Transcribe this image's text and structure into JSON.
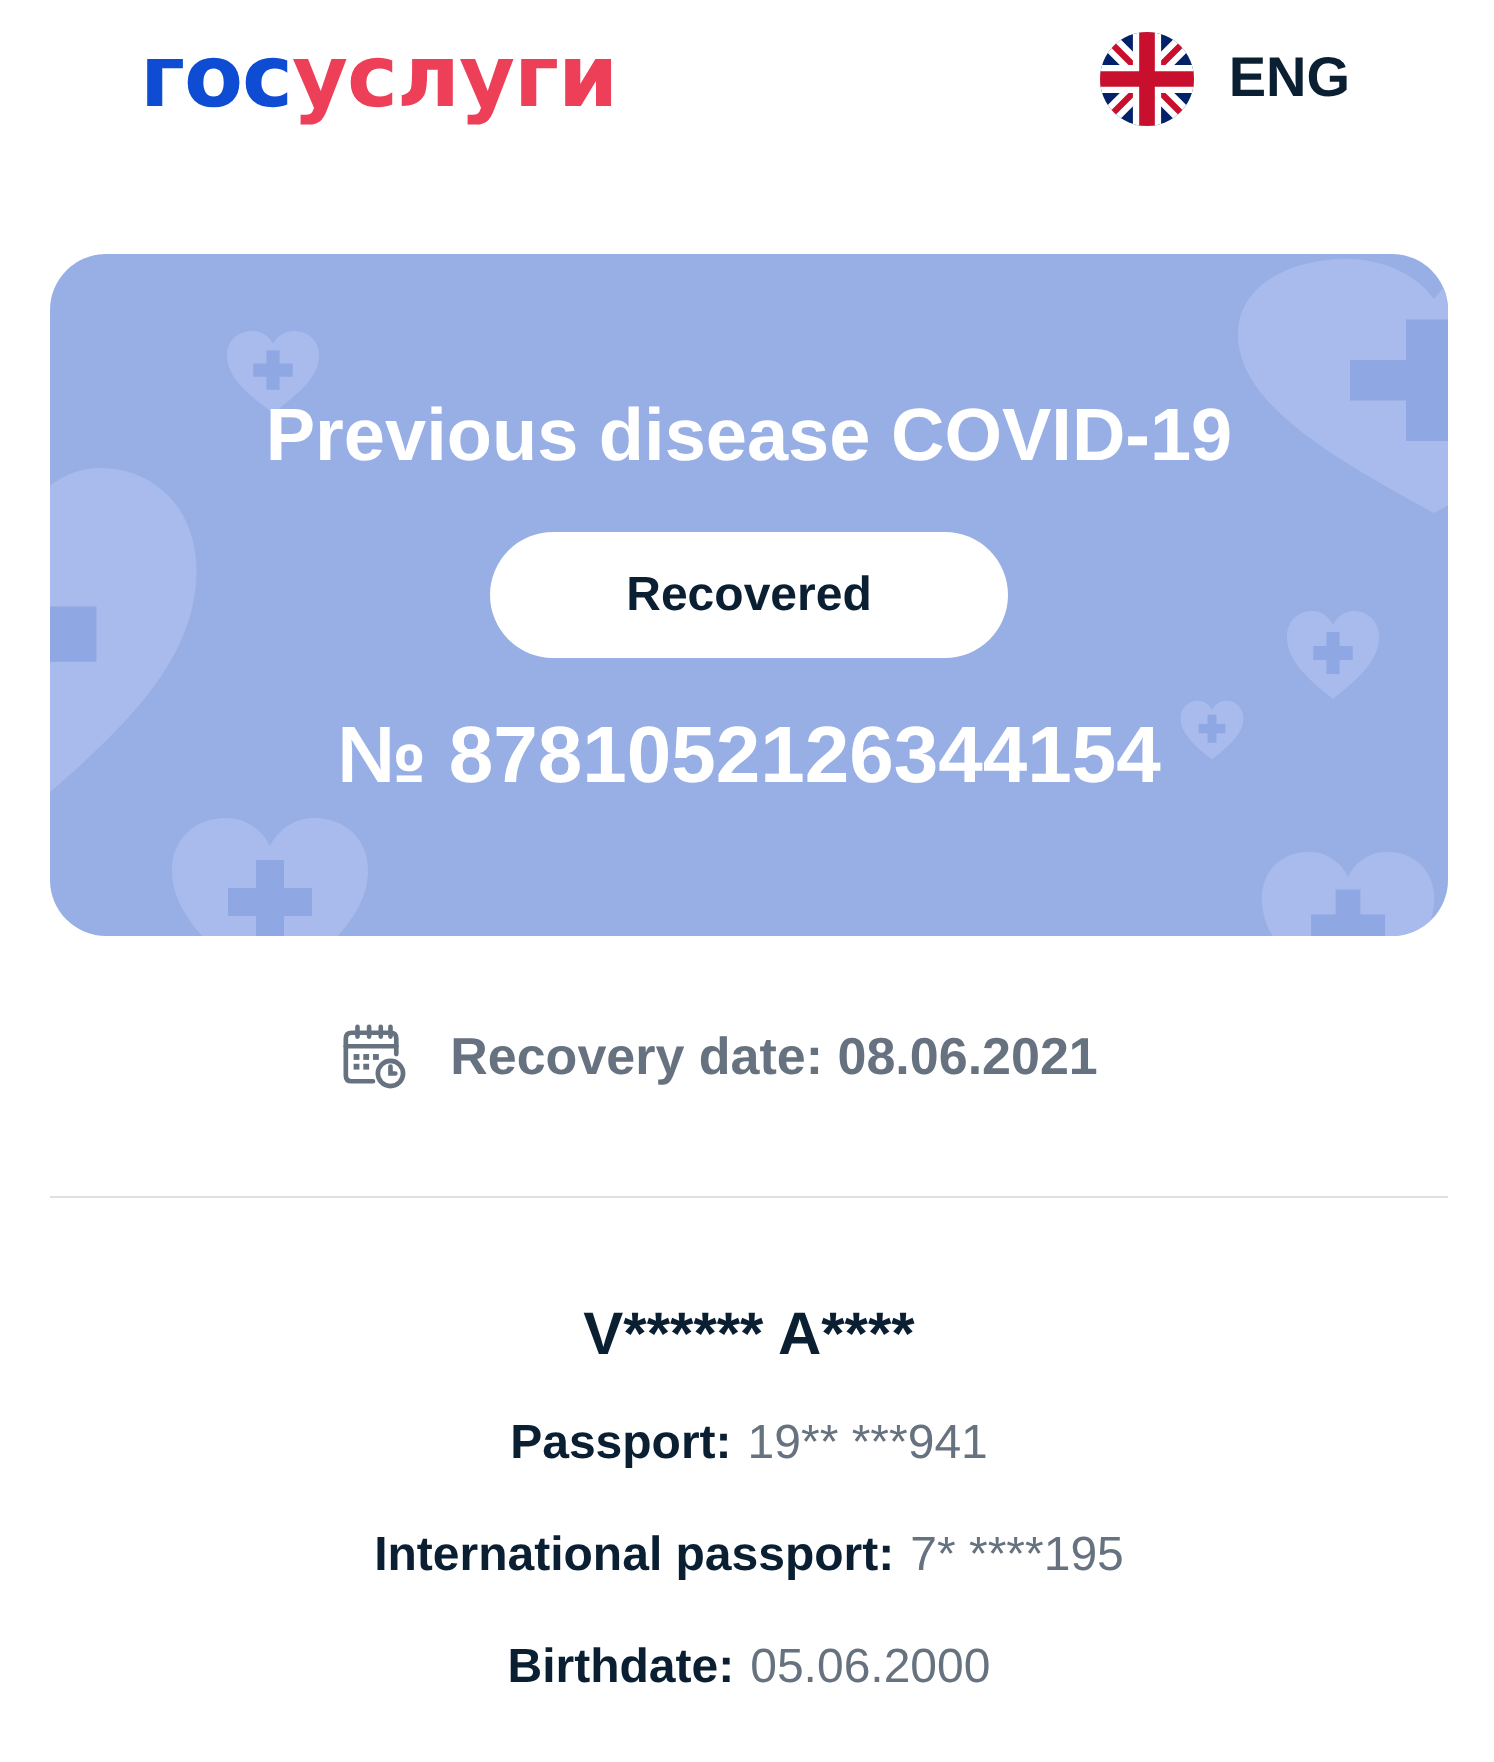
{
  "header": {
    "logo": [
      "гос",
      "услуги"
    ],
    "language": {
      "label": "ENG"
    }
  },
  "certificate": {
    "title": "Previous disease COVID-19",
    "status": "Recovered",
    "number": "№ 8781052126344154"
  },
  "recovery_date": "Recovery date: 08.06.2021",
  "person": {
    "name": "V****** A****",
    "fields": [
      {
        "label": "Passport:",
        "value": "19** ***941"
      },
      {
        "label": "International passport:",
        "value": "7* ****195"
      },
      {
        "label": "Birthdate:",
        "value": "05.06.2000"
      }
    ]
  }
}
